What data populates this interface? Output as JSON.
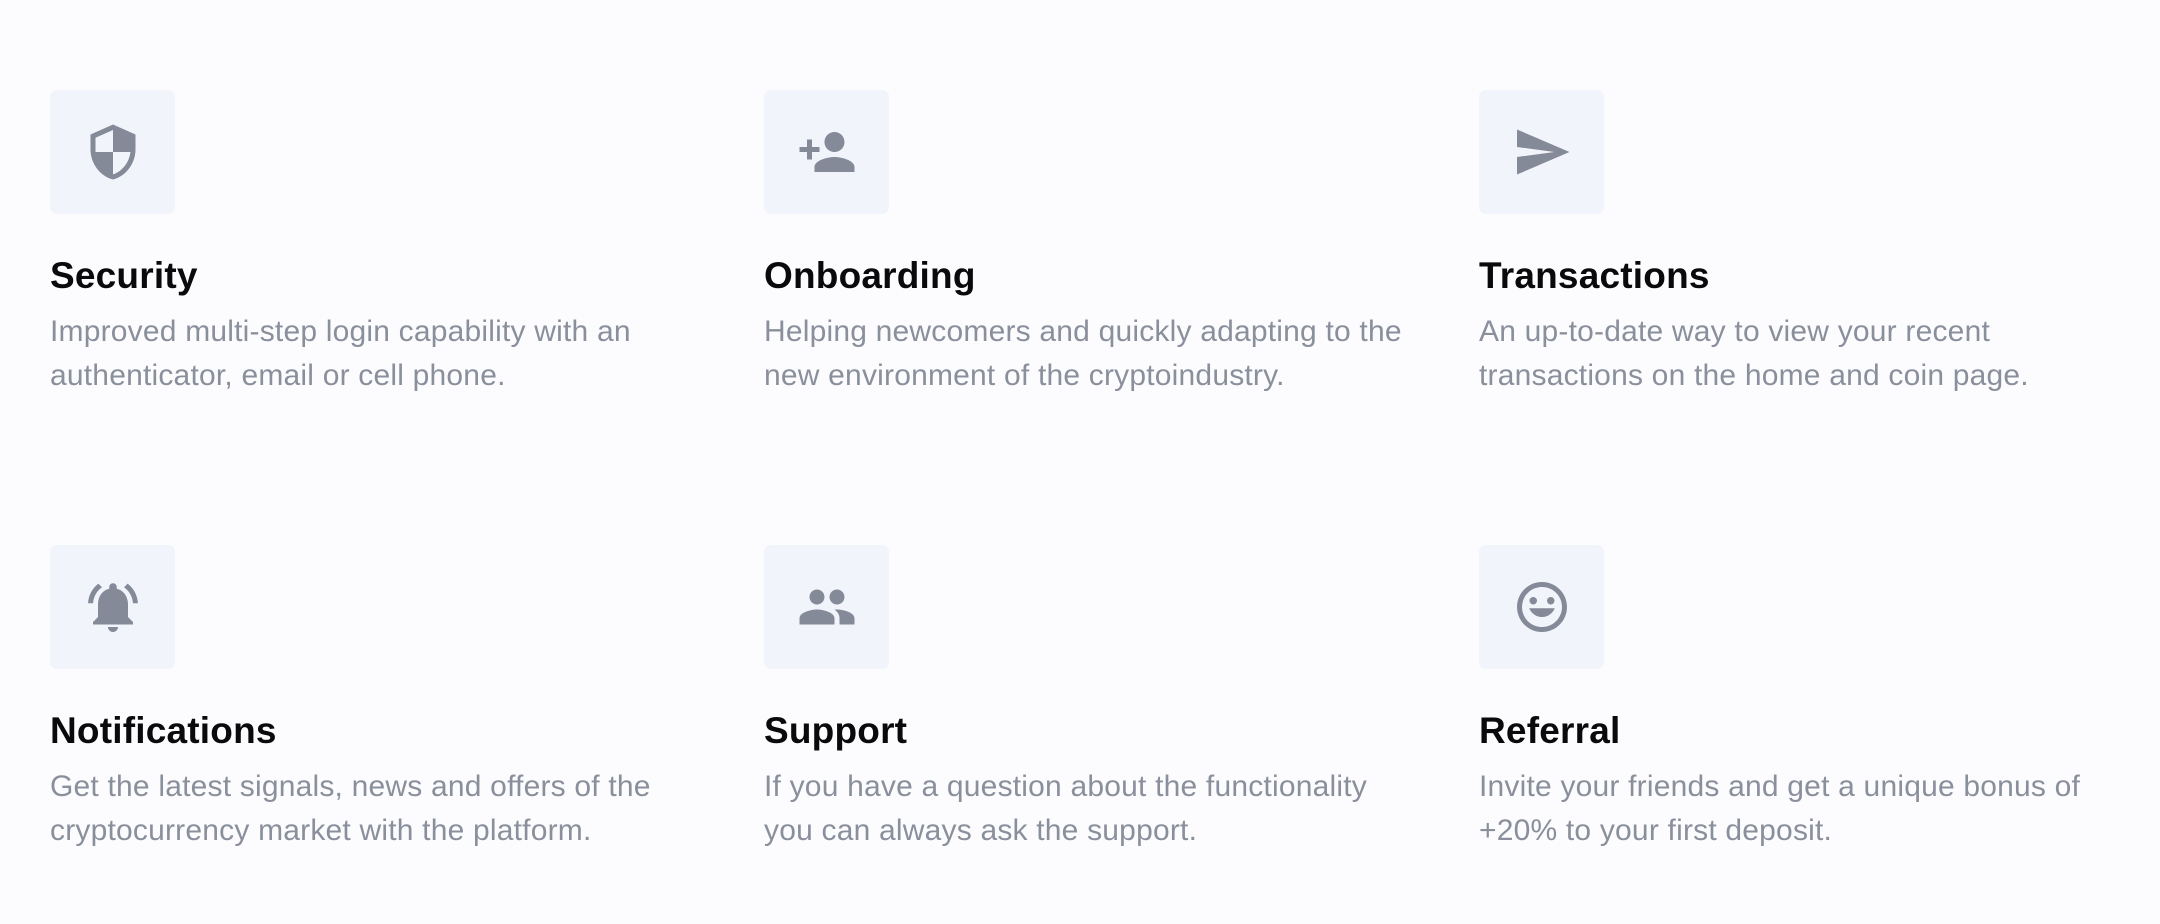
{
  "features": [
    {
      "icon": "shield-icon",
      "title": "Security",
      "description": "Improved multi-step login capability with an authenticator, email or cell phone."
    },
    {
      "icon": "person-add-icon",
      "title": "Onboarding",
      "description": "Helping newcomers and quickly adapting to the new environment of the cryptoindustry."
    },
    {
      "icon": "send-icon",
      "title": "Transactions",
      "description": "An up-to-date way to view your recent transactions on the home and coin page."
    },
    {
      "icon": "notifications-active-icon",
      "title": "Notifications",
      "description": "Get the latest signals, news and offers of the cryptocurrency market with the platform."
    },
    {
      "icon": "people-icon",
      "title": "Support",
      "description": "If you have a question about the functionality you can always ask the support."
    },
    {
      "icon": "smiley-icon",
      "title": "Referral",
      "description": "Invite your friends and get a unique bonus of +20% to your first deposit."
    }
  ],
  "colors": {
    "background": "#fcfcfe",
    "icon_box": "#f2f4fb",
    "icon": "#858a99",
    "title": "#0a0a0c",
    "description": "#8a8f9c"
  }
}
